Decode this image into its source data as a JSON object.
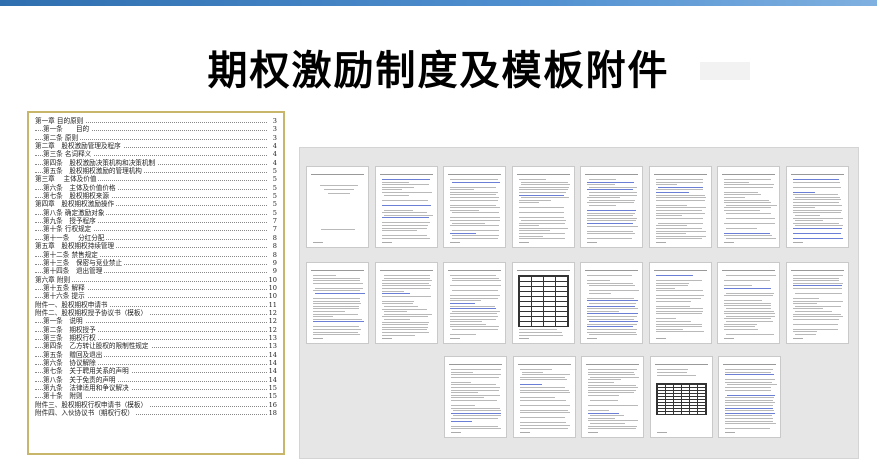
{
  "slide": {
    "title": "期权激励制度及模板附件"
  },
  "toc": [
    {
      "label": "第一章 目的原则",
      "page": "3",
      "level": 1
    },
    {
      "label": "第一条　　目的",
      "page": "3",
      "level": 2
    },
    {
      "label": "第二条 原则",
      "page": "3",
      "level": 2
    },
    {
      "label": "第二章　股权激励管理及程序",
      "page": "4",
      "level": 1
    },
    {
      "label": "第三条 名词释义",
      "page": "4",
      "level": 2
    },
    {
      "label": "第四条　股权激励决策机构和决策机制",
      "page": "4",
      "level": 2
    },
    {
      "label": "第五条　股权期权激励的管理机构",
      "page": "5",
      "level": 2
    },
    {
      "label": "第三章　 主体及价值",
      "page": "5",
      "level": 1
    },
    {
      "label": "第六条　主体及价值价格",
      "page": "5",
      "level": 2
    },
    {
      "label": "第七条　股权期权来源",
      "page": "5",
      "level": 2
    },
    {
      "label": "第四章　股权期权激励操作",
      "page": "5",
      "level": 1
    },
    {
      "label": "第八条 确定激励对象",
      "page": "5",
      "level": 2
    },
    {
      "label": "第九条　授予程序",
      "page": "7",
      "level": 2
    },
    {
      "label": "第十条 行权规定",
      "page": "7",
      "level": 2
    },
    {
      "label": "第十一条　 分红分配",
      "page": "8",
      "level": 2
    },
    {
      "label": "第五章　股权期权持续管理",
      "page": "8",
      "level": 1
    },
    {
      "label": "第十二条 禁售规定",
      "page": "8",
      "level": 2
    },
    {
      "label": "第十三条　保密与竞业禁止",
      "page": "9",
      "level": 2
    },
    {
      "label": "第十四条　退出管理",
      "page": "9",
      "level": 2
    },
    {
      "label": "第六章 附则",
      "page": "10",
      "level": 1
    },
    {
      "label": "第十五条 解释",
      "page": "10",
      "level": 2
    },
    {
      "label": "第十六条 提示",
      "page": "10",
      "level": 2
    },
    {
      "label": "附件一、股权期权申请书",
      "page": "11",
      "level": 1
    },
    {
      "label": "附件二、股权期权授予协议书（模板）",
      "page": "12",
      "level": 1
    },
    {
      "label": "第一条　说明",
      "page": "12",
      "level": 2
    },
    {
      "label": "第二条　期权授予",
      "page": "12",
      "level": 2
    },
    {
      "label": "第三条　期权行权",
      "page": "13",
      "level": 2
    },
    {
      "label": "第四条　乙方转让股权的限制性规定",
      "page": "13",
      "level": 2
    },
    {
      "label": "第五条　赠回及退出",
      "page": "14",
      "level": 2
    },
    {
      "label": "第六条　协议解除",
      "page": "14",
      "level": 2
    },
    {
      "label": "第七条　关于聘用关系的声明",
      "page": "14",
      "level": 2
    },
    {
      "label": "第八条　关于免责的声明",
      "page": "14",
      "level": 2
    },
    {
      "label": "第九条　法律适用和争议解决",
      "page": "15",
      "level": 2
    },
    {
      "label": "第十条　附则",
      "page": "15",
      "level": 2
    },
    {
      "label": "附件三、股权期权行权申请书（模板）",
      "page": "16",
      "level": 1
    },
    {
      "label": "附件四、入伙协议书（期权行权）",
      "page": "18",
      "level": 1
    }
  ],
  "thumbnails": [
    {
      "name": "page-1",
      "kind": "cover"
    },
    {
      "name": "page-2",
      "kind": "toc"
    },
    {
      "name": "page-3",
      "kind": "text"
    },
    {
      "name": "page-4",
      "kind": "text"
    },
    {
      "name": "page-5",
      "kind": "text"
    },
    {
      "name": "page-6",
      "kind": "text"
    },
    {
      "name": "page-7",
      "kind": "text"
    },
    {
      "name": "page-8",
      "kind": "text"
    },
    {
      "name": "page-9",
      "kind": "text"
    },
    {
      "name": "page-10",
      "kind": "text"
    },
    {
      "name": "page-11",
      "kind": "text"
    },
    {
      "name": "page-12",
      "kind": "table"
    },
    {
      "name": "page-13",
      "kind": "text"
    },
    {
      "name": "page-14",
      "kind": "text"
    },
    {
      "name": "page-15",
      "kind": "text"
    },
    {
      "name": "page-16",
      "kind": "text"
    },
    {
      "name": "page-17",
      "kind": "text"
    },
    {
      "name": "page-18",
      "kind": "text"
    },
    {
      "name": "page-19",
      "kind": "text"
    },
    {
      "name": "page-20",
      "kind": "table-dense"
    },
    {
      "name": "page-21",
      "kind": "text"
    }
  ],
  "colors": {
    "toc_border": "#c8b76a",
    "panel_bg": "#e6e6e6",
    "link_blue": "#6c7fd6"
  }
}
